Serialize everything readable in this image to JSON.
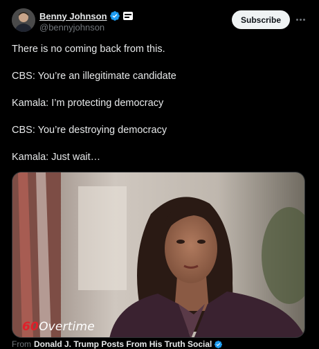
{
  "author": {
    "name": "Benny Johnson",
    "handle": "@bennyjohnson"
  },
  "actions": {
    "subscribe_label": "Subscribe"
  },
  "tweet_lines": [
    "There is no coming back from this.",
    "CBS: You’re an illegitimate candidate",
    "Kamala: I’m protecting democracy",
    "CBS: You’re destroying democracy",
    "Kamala: Just wait…"
  ],
  "media": {
    "watermark_60": "60",
    "watermark_overtime": "Overtime"
  },
  "source": {
    "prefix": "From",
    "name": "Donald J. Trump Posts From His Truth Social"
  },
  "colors": {
    "background": "#000000",
    "verified": "#1d9bf0",
    "text": "#e7e9ea",
    "secondary": "#71767b"
  },
  "icons": {
    "verified": "verified-badge-icon",
    "affiliation": "affiliation-badge-icon",
    "more": "more-icon"
  }
}
